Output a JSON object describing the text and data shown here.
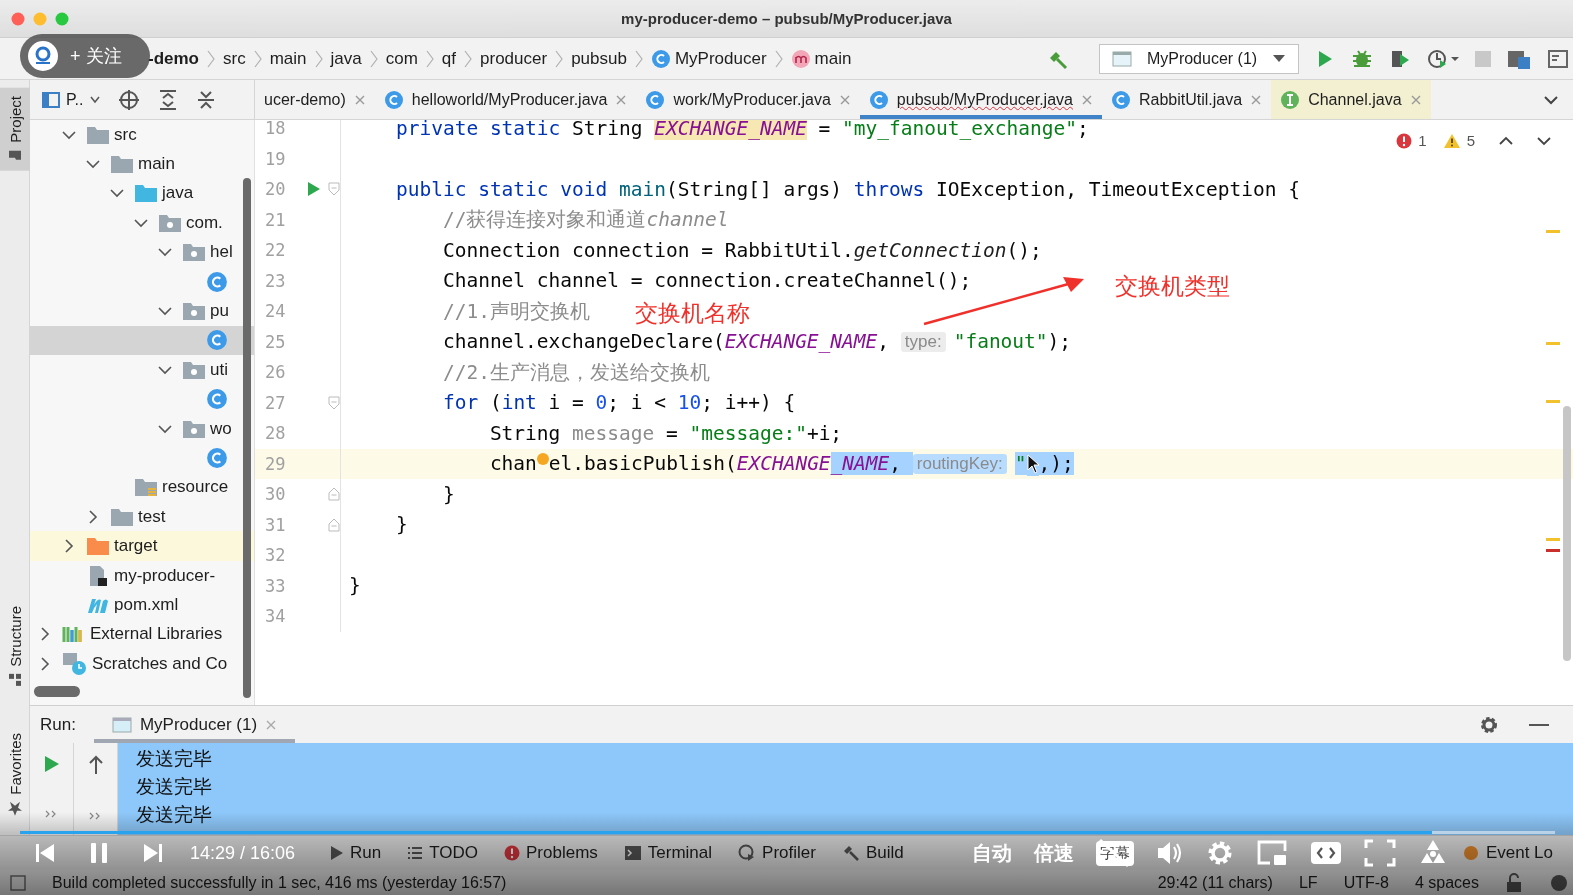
{
  "window": {
    "title": "my-producer-demo – pubsub/MyProducer.java"
  },
  "breadcrumbs": [
    {
      "label": "-demo",
      "kind": "module"
    },
    {
      "label": "src",
      "kind": "plain"
    },
    {
      "label": "main",
      "kind": "plain"
    },
    {
      "label": "java",
      "kind": "plain"
    },
    {
      "label": "com",
      "kind": "plain"
    },
    {
      "label": "qf",
      "kind": "plain"
    },
    {
      "label": "producer",
      "kind": "plain"
    },
    {
      "label": "pubsub",
      "kind": "plain"
    },
    {
      "label": "MyProducer",
      "kind": "class"
    },
    {
      "label": "main",
      "kind": "method"
    }
  ],
  "run_config": {
    "label": "MyProducer (1)"
  },
  "project_view": {
    "label": "P.."
  },
  "editor_tabs": [
    {
      "label": "ucer-demo)",
      "kind": "plain",
      "selected": false
    },
    {
      "label": "helloworld/MyProducer.java",
      "kind": "class",
      "selected": false
    },
    {
      "label": "work/MyProducer.java",
      "kind": "class",
      "selected": false
    },
    {
      "label": "pubsub/MyProducer.java",
      "kind": "class",
      "selected": true
    },
    {
      "label": "RabbitUtil.java",
      "kind": "class",
      "selected": false
    },
    {
      "label": "Channel.java",
      "kind": "interface",
      "selected": false
    }
  ],
  "inspections": {
    "errors": "1",
    "warnings": "5"
  },
  "code_lines": [
    {
      "number": "18",
      "current": false,
      "tokens": [
        {
          "text": "    private static ",
          "kind": "kw"
        },
        {
          "text": "String ",
          "kind": "plain"
        },
        {
          "text": "EXCHANGE_NAME",
          "kind": "field-hl"
        },
        {
          "text": " = ",
          "kind": "plain"
        },
        {
          "text": "\"my_fanout_exchange\"",
          "kind": "str"
        },
        {
          "text": ";",
          "kind": "plain"
        }
      ]
    },
    {
      "number": "19",
      "current": false
    },
    {
      "number": "20",
      "current": false,
      "gutter_icons": [
        {
          "kind": "run"
        },
        {
          "kind": "fold-start"
        }
      ],
      "tokens": [
        {
          "text": "    public static void ",
          "kind": "kw"
        },
        {
          "text": "main",
          "kind": "method"
        },
        {
          "text": "(String[] args) ",
          "kind": "plain"
        },
        {
          "text": "throws ",
          "kind": "kw"
        },
        {
          "text": "IOException, TimeoutException {",
          "kind": "plain"
        }
      ]
    },
    {
      "number": "21",
      "current": false,
      "tokens": [
        {
          "text": "        //获得连接对象和通道",
          "kind": "comment"
        },
        {
          "text": "channel",
          "kind": "comment-italic"
        }
      ]
    },
    {
      "number": "22",
      "current": false,
      "tokens": [
        {
          "text": "        Connection connection = RabbitUtil.",
          "kind": "plain"
        },
        {
          "text": "getConnection",
          "kind": "static"
        },
        {
          "text": "();",
          "kind": "plain"
        }
      ]
    },
    {
      "number": "23",
      "current": false,
      "tokens": [
        {
          "text": "        Channel channel = connection.createChannel();",
          "kind": "plain"
        }
      ]
    },
    {
      "number": "24",
      "current": false,
      "tokens": [
        {
          "text": "        //1.声明交换机",
          "kind": "comment"
        }
      ]
    },
    {
      "number": "25",
      "current": false,
      "tokens": [
        {
          "text": "        channel.exchangeDeclare(",
          "kind": "plain"
        },
        {
          "text": "EXCHANGE_NAME",
          "kind": "field"
        },
        {
          "text": ", ",
          "kind": "plain"
        },
        {
          "text": "type:",
          "kind": "hint"
        },
        {
          "text": "\"fanout\"",
          "kind": "str"
        },
        {
          "text": ");",
          "kind": "plain"
        }
      ]
    },
    {
      "number": "26",
      "current": false,
      "tokens": [
        {
          "text": "        //2.生产消息，发送给交换机",
          "kind": "comment"
        }
      ]
    },
    {
      "number": "27",
      "current": false,
      "gutter_icons": [
        {
          "kind": "fold-start"
        }
      ],
      "tokens": [
        {
          "text": "        for ",
          "kind": "kw"
        },
        {
          "text": "(",
          "kind": "plain"
        },
        {
          "text": "int ",
          "kind": "kw"
        },
        {
          "text": "i = ",
          "kind": "plain"
        },
        {
          "text": "0",
          "kind": "num"
        },
        {
          "text": "; i < ",
          "kind": "plain"
        },
        {
          "text": "10",
          "kind": "num"
        },
        {
          "text": "; i++) {",
          "kind": "plain"
        }
      ]
    },
    {
      "number": "28",
      "current": false,
      "tokens": [
        {
          "text": "            String ",
          "kind": "plain"
        },
        {
          "text": "message",
          "kind": "var-gray"
        },
        {
          "text": " = ",
          "kind": "plain"
        },
        {
          "text": "\"message:\"",
          "kind": "str"
        },
        {
          "text": "+i;",
          "kind": "plain"
        }
      ]
    },
    {
      "number": "29",
      "current": true,
      "tokens": [
        {
          "text": "            chan",
          "kind": "before-dot",
          "selected": false
        },
        {
          "text": "el.basicPublish(",
          "kind": "plain",
          "selected": false
        },
        {
          "text": "EXCHANGE",
          "kind": "field",
          "selected": false
        },
        {
          "text": "_NAME",
          "kind": "field",
          "selected": true
        },
        {
          "text": ", ",
          "kind": "plain",
          "selected": true
        },
        {
          "text": "routingKey:",
          "kind": "hint",
          "selected": true
        },
        {
          "text": "\"",
          "kind": "str-cursor",
          "selected": true
        },
        {
          "text": ",);",
          "kind": "plain",
          "selected": true
        }
      ]
    },
    {
      "number": "30",
      "current": false,
      "gutter_icons": [
        {
          "kind": "fold-end"
        }
      ],
      "tokens": [
        {
          "text": "        }",
          "kind": "plain"
        }
      ]
    },
    {
      "number": "31",
      "current": false,
      "gutter_icons": [
        {
          "kind": "fold-end"
        }
      ],
      "tokens": [
        {
          "text": "    }",
          "kind": "plain"
        }
      ]
    },
    {
      "number": "32",
      "current": false
    },
    {
      "number": "33",
      "current": false,
      "tokens": [
        {
          "text": "}",
          "kind": "plain"
        }
      ]
    },
    {
      "number": "34",
      "current": false
    }
  ],
  "annotations": [
    {
      "text": "交换机名称"
    },
    {
      "text": "交换机类型"
    }
  ],
  "project_tree": [
    {
      "kind": "module",
      "children": [
        {
          "label": "src",
          "kind": "folder",
          "expanded": true,
          "selected": false,
          "children": [
            {
              "label": "main",
              "kind": "folder",
              "expanded": true,
              "selected": false,
              "children": [
                {
                  "label": "java",
                  "kind": "source-folder",
                  "expanded": true,
                  "selected": false,
                  "children": [
                    {
                      "label": "com.",
                      "kind": "package",
                      "expanded": true,
                      "selected": false,
                      "children": [
                        {
                          "label": "hel",
                          "kind": "package",
                          "expanded": true,
                          "selected": false,
                          "children": [
                            {
                              "kind": "class",
                              "selected": false
                            }
                          ]
                        },
                        {
                          "label": "pu",
                          "kind": "package",
                          "expanded": true,
                          "selected": false,
                          "children": [
                            {
                              "kind": "class",
                              "selected": true
                            }
                          ]
                        },
                        {
                          "label": "uti",
                          "kind": "package",
                          "expanded": true,
                          "selected": false,
                          "children": [
                            {
                              "kind": "class",
                              "selected": false
                            }
                          ]
                        },
                        {
                          "label": "wo",
                          "kind": "package",
                          "expanded": true,
                          "selected": false,
                          "children": [
                            {
                              "kind": "class",
                              "selected": false
                            }
                          ]
                        }
                      ]
                    }
                  ]
                },
                {
                  "label": "resource",
                  "kind": "resources-folder",
                  "selected": false
                }
              ]
            },
            {
              "label": "test",
              "kind": "folder",
              "expanded": false,
              "selected": false
            }
          ]
        },
        {
          "label": "target",
          "kind": "excluded-folder",
          "expanded": false,
          "selected": false
        },
        {
          "label": "my-producer-",
          "kind": "module-file",
          "selected": false
        },
        {
          "label": "pom.xml",
          "kind": "maven-file",
          "selected": false
        }
      ]
    },
    {
      "label": "External Libraries",
      "kind": "libraries",
      "expanded": false,
      "selected": false
    },
    {
      "label": "Scratches and Co",
      "kind": "scratches",
      "expanded": false,
      "selected": false
    }
  ],
  "side_tabs": [
    {
      "label": "Project",
      "kind": "project",
      "selected": true
    },
    {
      "label": "Structure",
      "kind": "structure",
      "selected": false
    },
    {
      "label": "Favorites",
      "kind": "favorites",
      "selected": false
    }
  ],
  "run_panel": {
    "label": "Run:",
    "tabs": [
      {
        "label": "MyProducer (1)",
        "selected": true
      }
    ],
    "output": [
      "发送完毕",
      "发送完毕",
      "发送完毕"
    ]
  },
  "tool_tabs": [
    {
      "label": "Run",
      "kind": "run"
    },
    {
      "label": "TODO",
      "kind": "todo"
    },
    {
      "label": "Problems",
      "kind": "problems"
    },
    {
      "label": "Terminal",
      "kind": "terminal"
    },
    {
      "label": "Profiler",
      "kind": "profiler"
    },
    {
      "label": "Build",
      "kind": "build"
    },
    {
      "label": "Event Lo",
      "kind": "event-log"
    }
  ],
  "status_bar": {
    "message": "Build completed successfully in 1 sec, 416 ms (yesterday 16:57)",
    "items": [
      "29:42 (11 chars)",
      "LF",
      "UTF-8",
      "4 spaces"
    ]
  },
  "player": {
    "follow": "+ 关注",
    "time": "14:29 / 16:06",
    "level": 0.92,
    "quality": "自动",
    "speed": "倍速",
    "subtitle": "字幕"
  }
}
